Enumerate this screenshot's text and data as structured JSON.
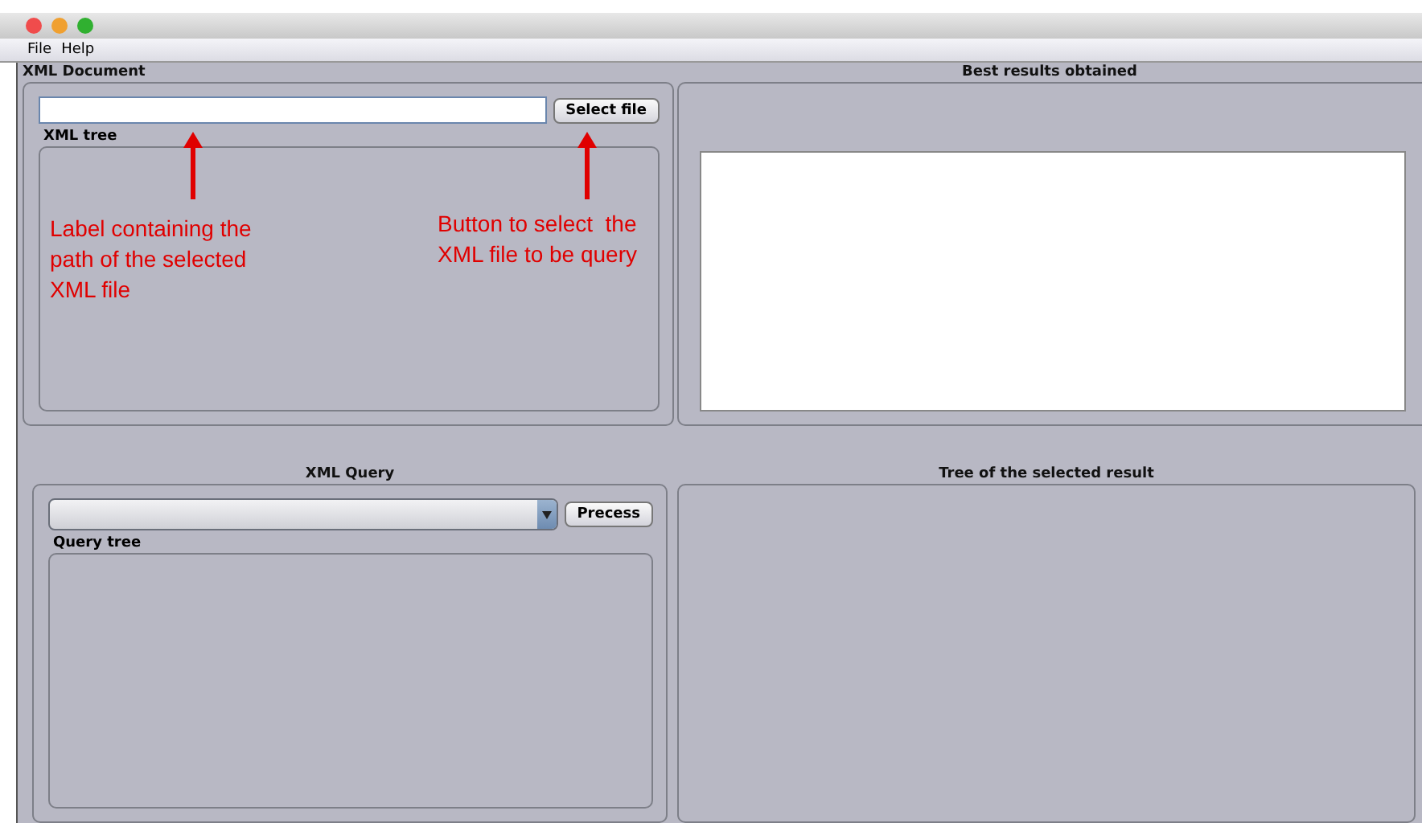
{
  "menu": [
    "File",
    "Help"
  ],
  "xml_document": {
    "title": "XML Document",
    "button": "Select file",
    "tree_title": "XML tree"
  },
  "best_results": {
    "title": "Best results obtained"
  },
  "xml_query": {
    "title": "XML Query",
    "button": "Precess",
    "tree_title": "Query tree"
  },
  "selected_result": {
    "title": "Tree of the selected result"
  },
  "annotations": [
    {
      "text": "Label containing the path of the selected XML file"
    },
    {
      "text": "Button to select  the XML file to be query"
    }
  ]
}
